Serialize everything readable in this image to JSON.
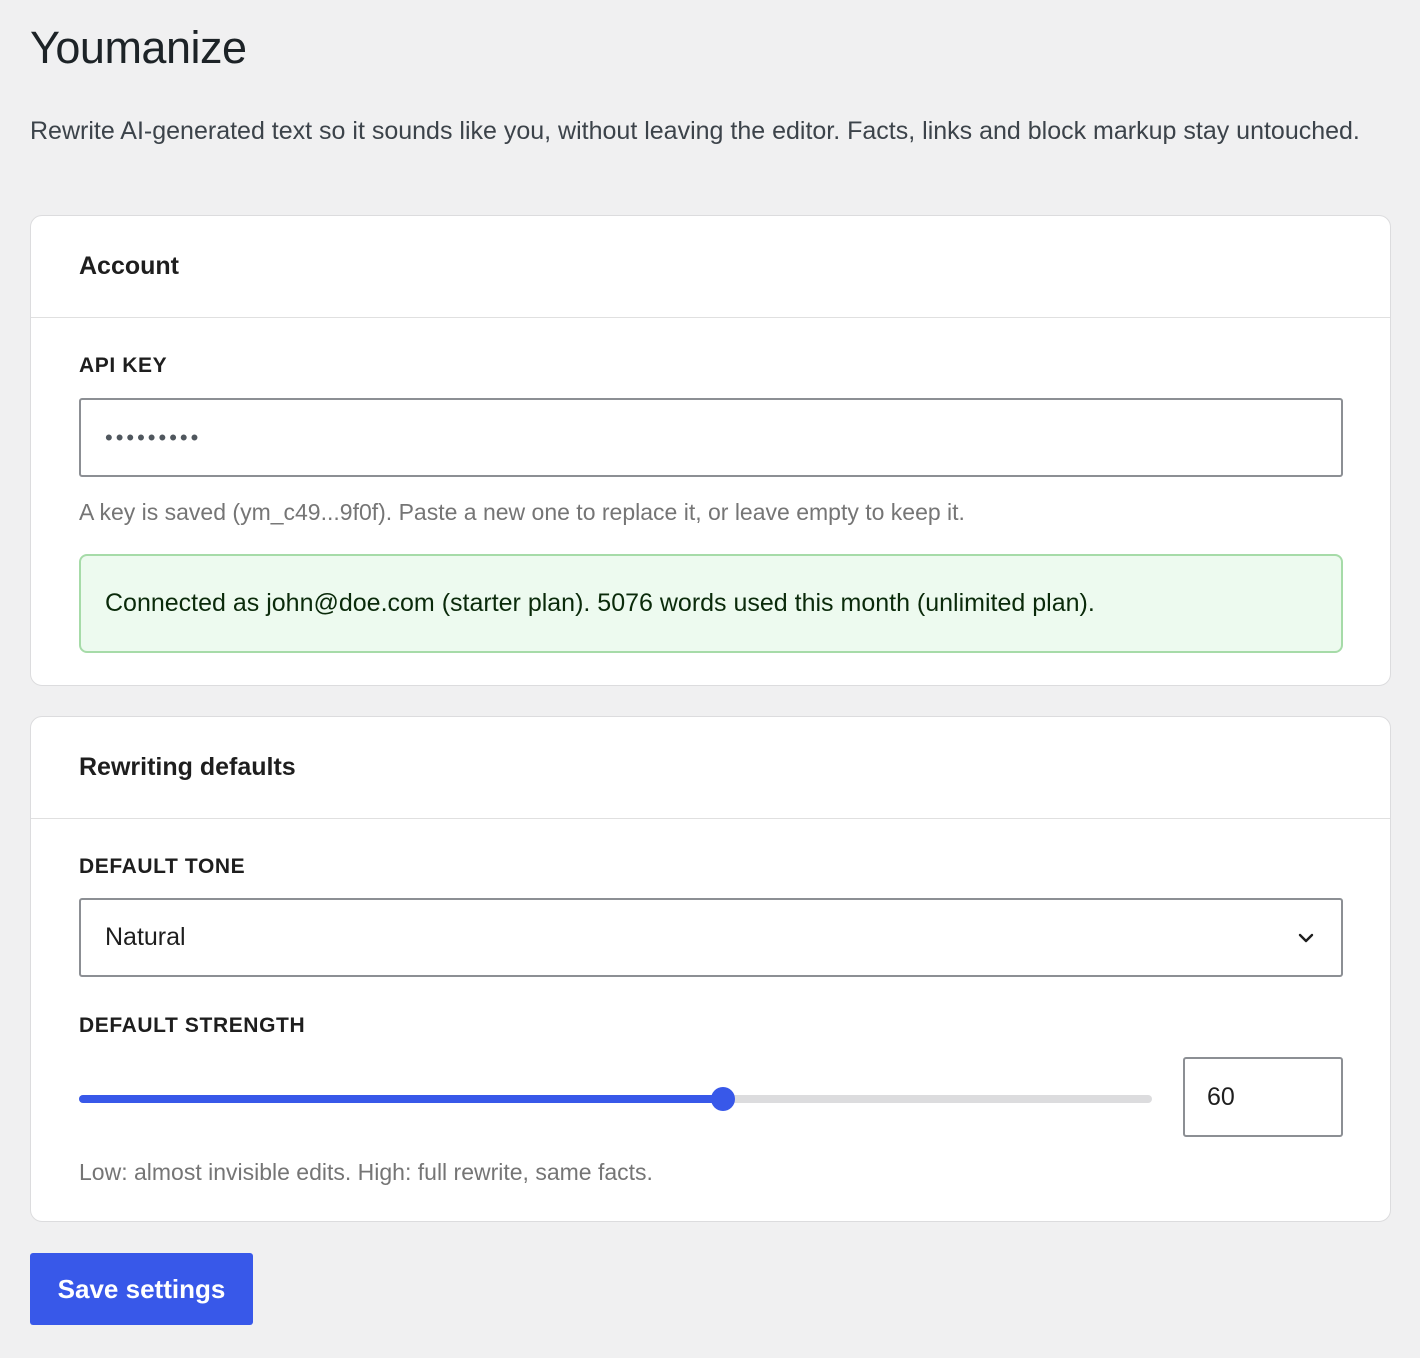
{
  "page": {
    "title": "Youmanize",
    "intro": "Rewrite AI-generated text so it sounds like you, without leaving the editor. Facts, links and block markup stay untouched."
  },
  "account": {
    "title": "Account",
    "api_key_label": "API KEY",
    "api_key_value": "•••••••••",
    "api_key_help": "A key is saved (ym_c49...9f0f). Paste a new one to replace it, or leave empty to keep it.",
    "status_message": "Connected as john@doe.com (starter plan). 5076 words used this month (unlimited plan)."
  },
  "rewriting": {
    "title": "Rewriting defaults",
    "tone_label": "DEFAULT TONE",
    "tone_value": "Natural",
    "strength_label": "DEFAULT STRENGTH",
    "strength_value": "60",
    "strength_min": 0,
    "strength_max": 100,
    "strength_help": "Low: almost invisible edits. High: full rewrite, same facts."
  },
  "actions": {
    "save_label": "Save settings"
  },
  "colors": {
    "accent": "#3858e9",
    "background": "#f0f0f1",
    "success_bg": "#edfaef",
    "success_border": "#a6dba8"
  },
  "icons": {
    "select_chevron": "chevron-down-icon"
  }
}
